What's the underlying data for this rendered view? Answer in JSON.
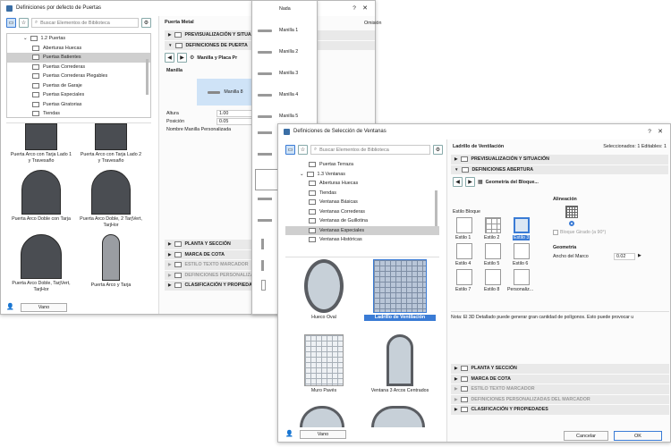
{
  "left_win": {
    "title": "Definiciones por defecto de Puertas",
    "search_placeholder": "Buscar Elementos de Biblioteca",
    "tree": [
      "1.2 Puertas",
      "Aberturas Huecas",
      "Puertas Batientes",
      "Puertas Correderas",
      "Puertas Correderas Plegables",
      "Puertas de Garaje",
      "Puertas Especiales",
      "Puertas Giratorias",
      "Tiendas"
    ],
    "thumbs": [
      "Puerta Arco con Tarja Lado 1 y Travesaño",
      "Puerta Arco con Tarja Lado 2 y Travesaño",
      "Puerta Arco Doble con Tarja",
      "Puerta Arco Doble, 2 TarjVert, TarjHor",
      "Puerta Arco Doble, TarjVert, TarjHor",
      "Puerta Arco y Tarja"
    ],
    "vano": "Vano",
    "panel_title": "Puerta Metal",
    "sections": [
      "PREVISUALIZACIÓN Y SITUACIÓ",
      "DEFINICIONES DE PUERTA"
    ],
    "subpanel": "Manilla y Placa Pr",
    "manilla_label": "Manilla",
    "manilla_sel": "Manilla 8",
    "fields": [
      {
        "k": "Altura",
        "v": "1.00"
      },
      {
        "k": "Posición",
        "v": "0.05"
      },
      {
        "k": "Nombre Manilla Personalizada",
        "v": ""
      }
    ],
    "bottom_sections": [
      "PLANTA Y SECCIÓN",
      "MARCA DE COTA",
      "ESTILO TEXTO MARCADOR",
      "DEFINICIONES PERSONALIZA",
      "CLASIFICACIÓN Y PROPIEDADE"
    ]
  },
  "popup": {
    "items": [
      "Nada",
      "Manilla 1",
      "Manilla 2",
      "Manilla 3",
      "Manilla 4",
      "Manilla 5"
    ],
    "omission": "Omisión"
  },
  "right_win": {
    "title": "Definiciones de Selección de Ventanas",
    "search_placeholder": "Buscar Elementos de Biblioteca",
    "tree": [
      "Puertas Terraza",
      "1.3 Ventanas",
      "Aberturas Huecas",
      "Tiendas",
      "Ventanas Básicas",
      "Ventanas Correderas",
      "Ventanas de Guillotina",
      "Ventanas Especiales",
      "Ventanas Históricas"
    ],
    "thumbs": [
      "Hueco Oval",
      "Ladrillo de Ventilación",
      "Muro Pavés",
      "Ventana 3 Arcos Centrados"
    ],
    "vano": "Vano",
    "panel_title": "Ladrillo de Ventilación",
    "selected_info": "Seleccionados: 1 Editables: 1",
    "sections": [
      "PREVISUALIZACIÓN Y SITUACIÓN",
      "DEFINICIONES ABERTURA"
    ],
    "subpanel": "Geometría del Bloque...",
    "estilo_label": "Estilo Bloque",
    "estilos": [
      "Estilo 1",
      "Estilo 2",
      "Estilo 3",
      "Estilo 4",
      "Estilo 5",
      "Estilo 6",
      "Estilo 7",
      "Estilo 8",
      "Personaliz..."
    ],
    "alineacion": "Alineación",
    "bloque_girado": "Bloque Girado (a 90°)",
    "geometria": "Geometría",
    "ancho_label": "Ancho del Marco",
    "ancho_value": "0.02",
    "note": "Nota: El 3D Detallado puede generar gran cantidad de polígonos. Esto puede provocar u",
    "bottom_sections": [
      "PLANTA Y SECCIÓN",
      "MARCA DE COTA",
      "ESTILO TEXTO MARCADOR",
      "DEFINICIONES PERSONALIZADAS DEL MARCADOR",
      "CLASIFICACIÓN Y PROPIEDADES"
    ],
    "cancel": "Cancelar",
    "ok": "OK"
  }
}
